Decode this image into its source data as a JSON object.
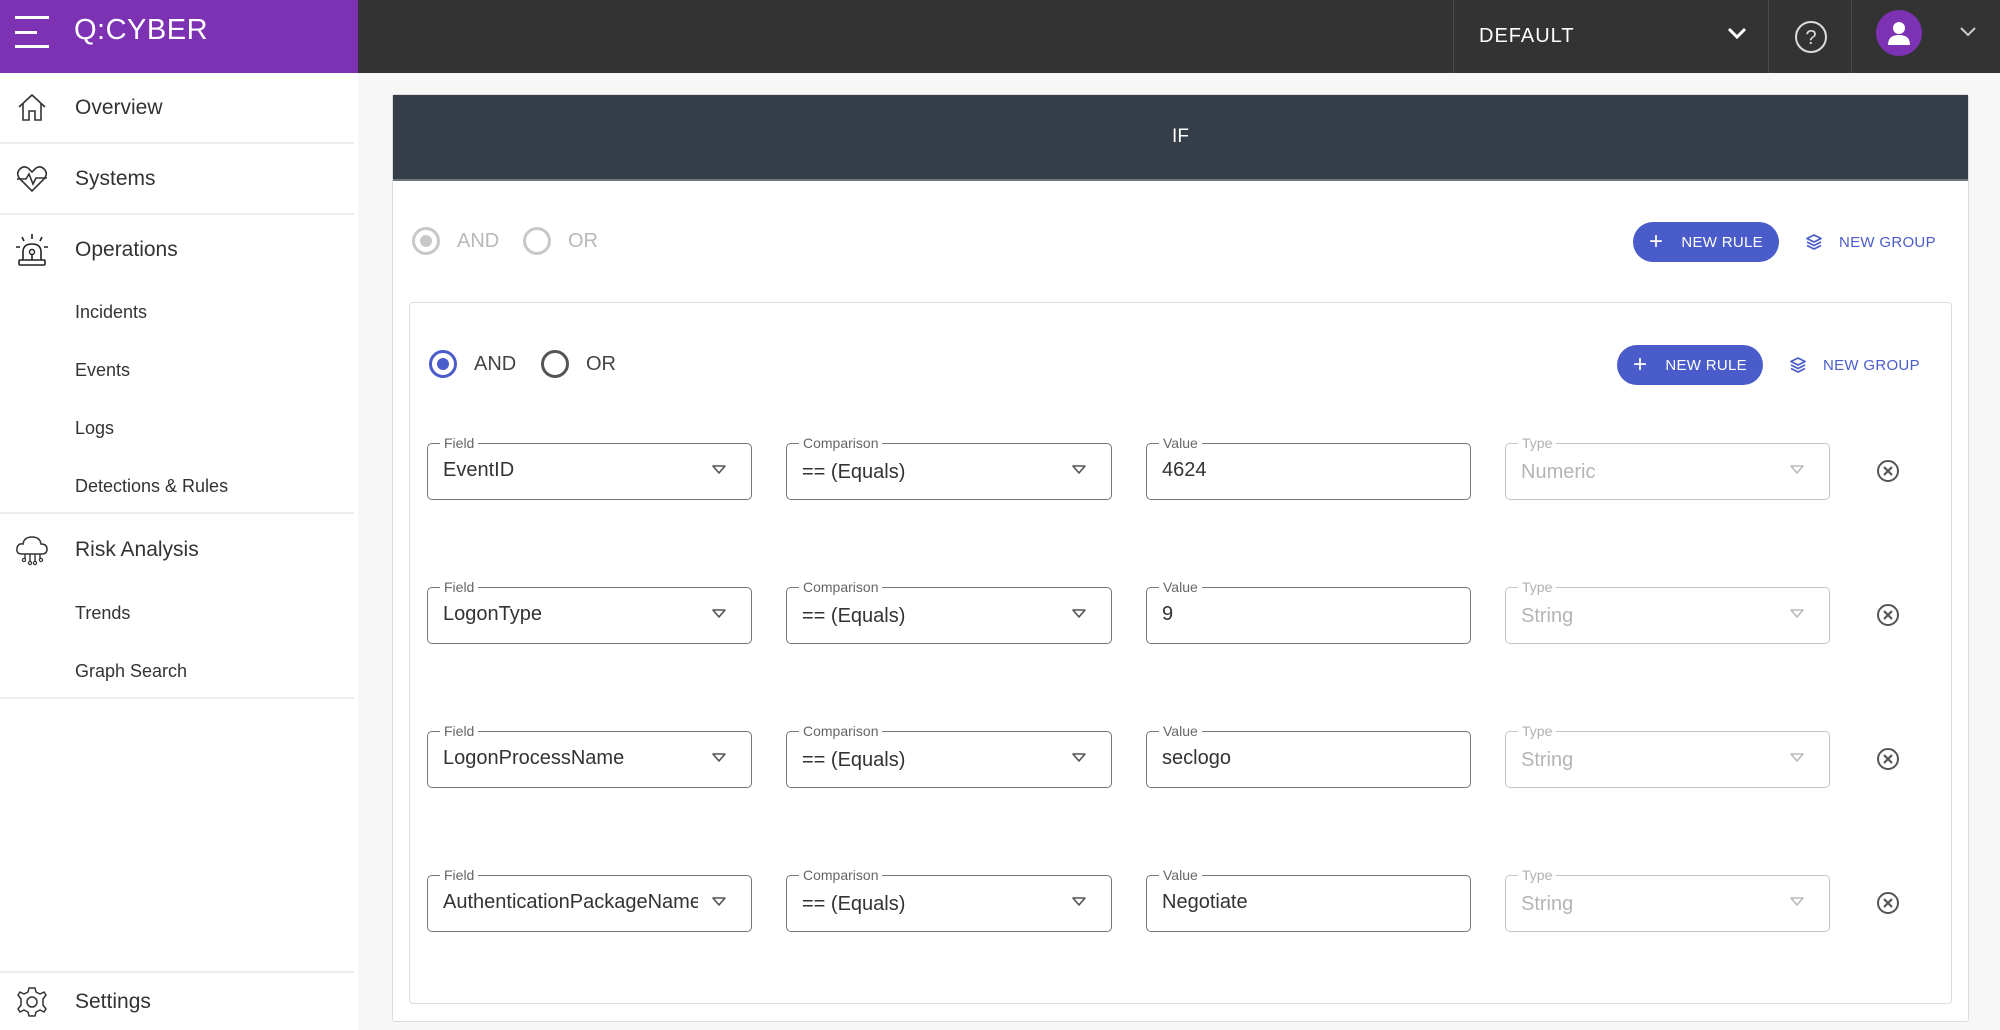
{
  "topbar": {
    "logo": "Q:CYBER",
    "workspace": "DEFAULT",
    "brand_color": "#7d32b4"
  },
  "sidebar": {
    "items": [
      {
        "label": "Overview",
        "icon": "home-icon"
      },
      {
        "label": "Systems",
        "icon": "heart-pulse-icon"
      },
      {
        "label": "Operations",
        "icon": "siren-icon",
        "children": [
          "Incidents",
          "Events",
          "Logs",
          "Detections & Rules"
        ]
      },
      {
        "label": "Risk Analysis",
        "icon": "cloud-network-icon",
        "children": [
          "Trends",
          "Graph Search"
        ]
      }
    ],
    "settings": "Settings"
  },
  "builder": {
    "header": "IF",
    "accent_color": "#4a5cc9",
    "outer": {
      "and": "AND",
      "or": "OR",
      "selected": "AND",
      "new_rule": "NEW RULE",
      "new_group": "NEW GROUP"
    },
    "inner": {
      "and": "AND",
      "or": "OR",
      "selected": "AND",
      "new_rule": "NEW RULE",
      "new_group": "NEW GROUP"
    },
    "labels": {
      "field": "Field",
      "comparison": "Comparison",
      "value": "Value",
      "type": "Type"
    },
    "rules": [
      {
        "field": "EventID",
        "comparison": "== (Equals)",
        "value": "4624",
        "type": "Numeric"
      },
      {
        "field": "LogonType",
        "comparison": "== (Equals)",
        "value": "9",
        "type": "String"
      },
      {
        "field": "LogonProcessName",
        "comparison": "== (Equals)",
        "value": "seclogo",
        "type": "String"
      },
      {
        "field": "AuthenticationPackageName",
        "comparison": "== (Equals)",
        "value": "Negotiate",
        "type": "String"
      }
    ]
  }
}
